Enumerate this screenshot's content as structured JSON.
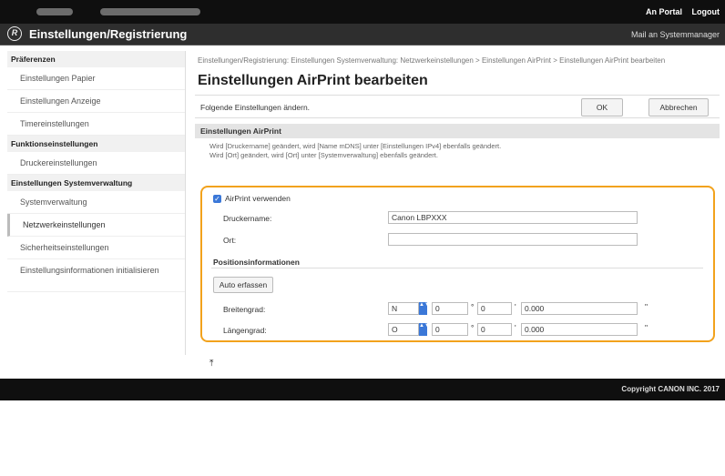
{
  "header": {
    "links": [
      "An Portal",
      "Logout"
    ],
    "title": "Einstellungen/Registrierung",
    "mail": "Mail an Systemmanager"
  },
  "sidebar": {
    "groups": [
      {
        "label": "Präferenzen",
        "items": [
          "Einstellungen Papier",
          "Einstellungen Anzeige",
          "Timereinstellungen"
        ]
      },
      {
        "label": "Funktionseinstellungen",
        "items": [
          "Druckereinstellungen"
        ]
      },
      {
        "label": "Einstellungen Systemverwaltung",
        "items": [
          "Systemverwaltung",
          "Netzwerkeinstellungen",
          "Sicherheitseinstellungen",
          "Einstellungsinformationen initialisieren"
        ]
      }
    ]
  },
  "main": {
    "breadcrumb": "Einstellungen/Registrierung: Einstellungen Systemverwaltung: Netzwerkeinstellungen > Einstellungen AirPrint > Einstellungen AirPrint bearbeiten",
    "title": "Einstellungen AirPrint bearbeiten",
    "desc": "Folgende Einstellungen ändern.",
    "ok": "OK",
    "cancel": "Abbrechen",
    "section": "Einstellungen AirPrint",
    "note1": "Wird [Druckername] geändert, wird [Name mDNS] unter [Einstellungen IPv4] ebenfalls geändert.",
    "note2": "Wird [Ort] geändert, wird [Ort] unter [Systemverwaltung] ebenfalls geändert.",
    "use_airprint": "AirPrint verwenden",
    "printer_name_label": "Druckername:",
    "printer_name_value": "Canon LBPXXX",
    "location_label": "Ort:",
    "location_value": "",
    "position_section": "Positionsinformationen",
    "auto_button": "Auto erfassen",
    "lat_label": "Breitengrad:",
    "lat_dir": "N",
    "lat_deg": "0",
    "lat_min": "0",
    "lat_sec": "0.000",
    "lon_label": "Längengrad:",
    "lon_dir": "O",
    "lon_deg": "0",
    "lon_min": "0",
    "lon_sec": "0.000",
    "deg_sym": "°",
    "min_sym": "'",
    "sec_sym": "\""
  },
  "footer": {
    "copyright": "Copyright CANON INC. 2017"
  },
  "colors": {
    "accent": "#f2a21c",
    "checkbox": "#3b78d8"
  }
}
